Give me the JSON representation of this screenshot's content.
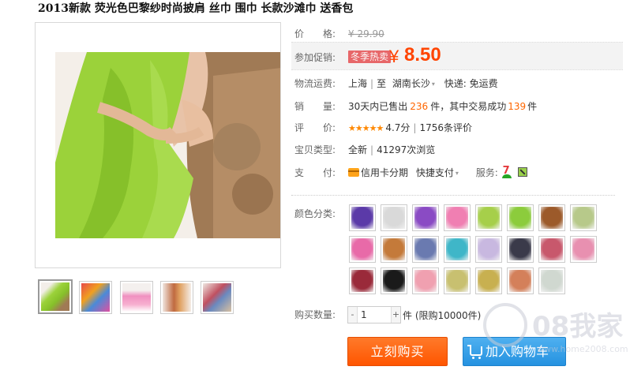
{
  "product": {
    "title": "2013新款 荧光色巴黎纱时尚披肩 丝巾 围巾 长款沙滩巾 送香包"
  },
  "price": {
    "label": "价　　格:",
    "original": "¥ 29.90"
  },
  "promotion": {
    "label": "参加促销:",
    "tag": "冬季热卖",
    "symbol": "¥",
    "price": "8.50"
  },
  "shipping": {
    "label": "物流运费:",
    "from": "上海",
    "to_prefix": "至",
    "to": "湖南长沙",
    "fee": "快递: 免运费"
  },
  "sales": {
    "label": "销　　量:",
    "prefix": "30天内已售出",
    "sold": "236",
    "mid": "件，其中交易成功",
    "success": "139",
    "suffix": "件"
  },
  "rating": {
    "label": "评　　价:",
    "stars": "★★★★★",
    "score": "4.7分",
    "reviews": "1756条评价"
  },
  "type": {
    "label": "宝贝类型:",
    "condition": "全新",
    "views": "41297次浏览"
  },
  "payment": {
    "label": "支　　付:",
    "credit": "信用卡分期",
    "quick": "快捷支付",
    "service_label": "服务:"
  },
  "colors": {
    "label": "颜色分类:",
    "swatches": [
      "#5b3aa8",
      "#d9d9d9",
      "#8a4bc4",
      "#f07fb2",
      "#a6cf4a",
      "#8ccc3c",
      "#9c5a2a",
      "#b7c98a",
      "#e86aa8",
      "#c47a3a",
      "#6a7ab0",
      "#3fb6c8",
      "#c8b8e0",
      "#3a3a4a",
      "#c8586c",
      "#e890b0",
      "#9a2a3a",
      "#1a1a1a",
      "#f0a0b0",
      "#c8c070",
      "#c8b050",
      "#d4805a",
      "#d0d8d0"
    ]
  },
  "quantity": {
    "label": "购买数量:",
    "value": "1",
    "unit": "件 (限购10000件)"
  },
  "actions": {
    "buy": "立刻购买",
    "cart": "加入购物车"
  },
  "watermark": {
    "text": "08我家",
    "url": "www.home2008.com"
  },
  "colors_theme": {
    "accent": "#ff4400",
    "buy_button": "#ff6600",
    "cart_button": "#2b96e2",
    "sales_highlight": "#ff6600"
  }
}
